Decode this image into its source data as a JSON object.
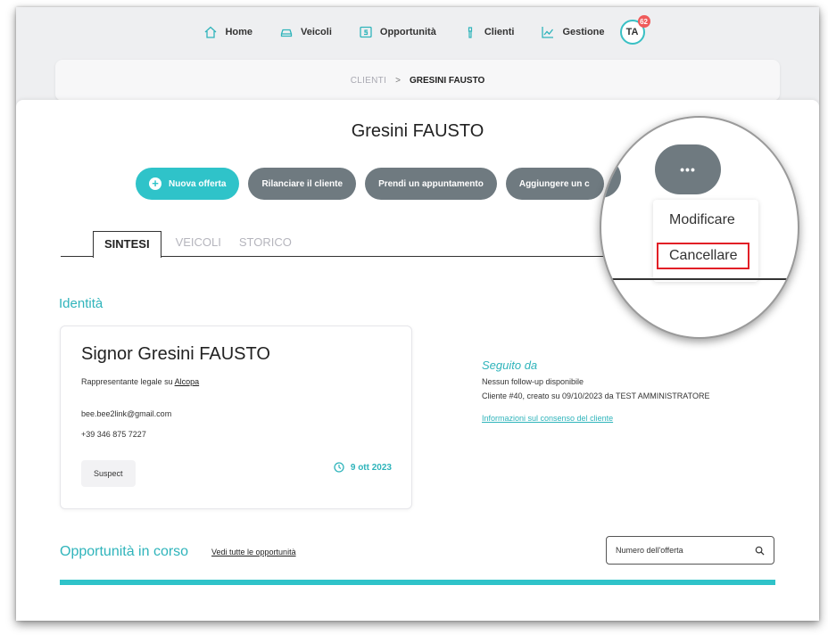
{
  "nav": {
    "items": [
      {
        "label": "Home",
        "icon": "home-icon"
      },
      {
        "label": "Veicoli",
        "icon": "car-icon"
      },
      {
        "label": "Opportunità",
        "icon": "opportunity-icon"
      },
      {
        "label": "Clienti",
        "icon": "person-icon"
      },
      {
        "label": "Gestione",
        "icon": "chart-icon"
      }
    ],
    "avatar_initials": "TA",
    "avatar_badge": "62"
  },
  "breadcrumb": {
    "parent": "CLIENTI",
    "current": "GRESINI FAUSTO"
  },
  "client": {
    "title": "Gresini FAUSTO"
  },
  "actions": {
    "new_offer": "Nuova offerta",
    "relaunch": "Rilanciare il cliente",
    "appointment": "Prendi un appuntamento",
    "add_partial": "Aggiungere un c"
  },
  "tabs": [
    {
      "label": "SINTESI",
      "active": true
    },
    {
      "label": "VEICOLI",
      "active": false
    },
    {
      "label": "STORICO",
      "active": false
    }
  ],
  "identity": {
    "section_title": "Identità",
    "name": "Signor Gresini FAUSTO",
    "legal_rep_prefix": "Rappresentante legale su",
    "legal_rep_link": "Alcopa",
    "email": "bee.bee2link@gmail.com",
    "phone": "+39 346 875 7227",
    "status": "Suspect",
    "date": "9 ott 2023"
  },
  "followup": {
    "title": "Seguito da",
    "none": "Nessun follow-up disponibile",
    "client_info": "Cliente #40, creato su 09/10/2023 da",
    "creator": "TEST AMMINISTRATORE",
    "consent_link": "Informazioni sul consenso del cliente"
  },
  "opportunities": {
    "title": "Opportunità in corso",
    "see_all": "Vedi tutte le opportunità",
    "search_placeholder": "Numero dell'offerta"
  },
  "magnifier": {
    "more_label": "•••",
    "menu": {
      "edit": "Modificare",
      "delete": "Cancellare"
    }
  },
  "colors": {
    "accent": "#2fc3c9",
    "button_gray": "#6f7a80",
    "highlight_red": "#e21f26"
  }
}
